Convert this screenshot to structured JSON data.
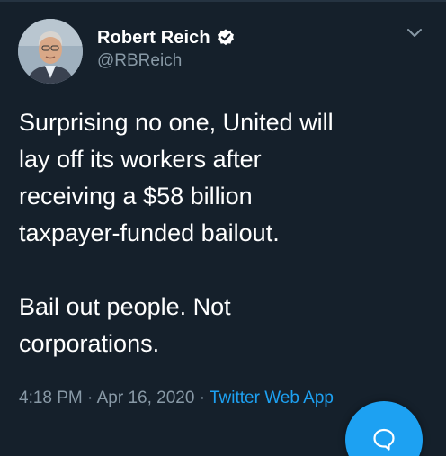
{
  "tweet": {
    "display_name": "Robert Reich",
    "handle": "@RBReich",
    "text": "Surprising no one, United will\nlay off its workers after\nreceiving a $58 billion\ntaxpayer-funded bailout.\n\nBail out people. Not\ncorporations.",
    "time": "4:18 PM",
    "separator": " · ",
    "date": "Apr 16, 2020",
    "source": "Twitter Web App"
  },
  "icons": {
    "verified": "verified-badge-icon",
    "menu": "chevron-down-icon",
    "compose": "compose-tweet-icon"
  },
  "colors": {
    "background": "#15202b",
    "accent": "#1da1f2",
    "secondary_text": "#8899a6"
  }
}
